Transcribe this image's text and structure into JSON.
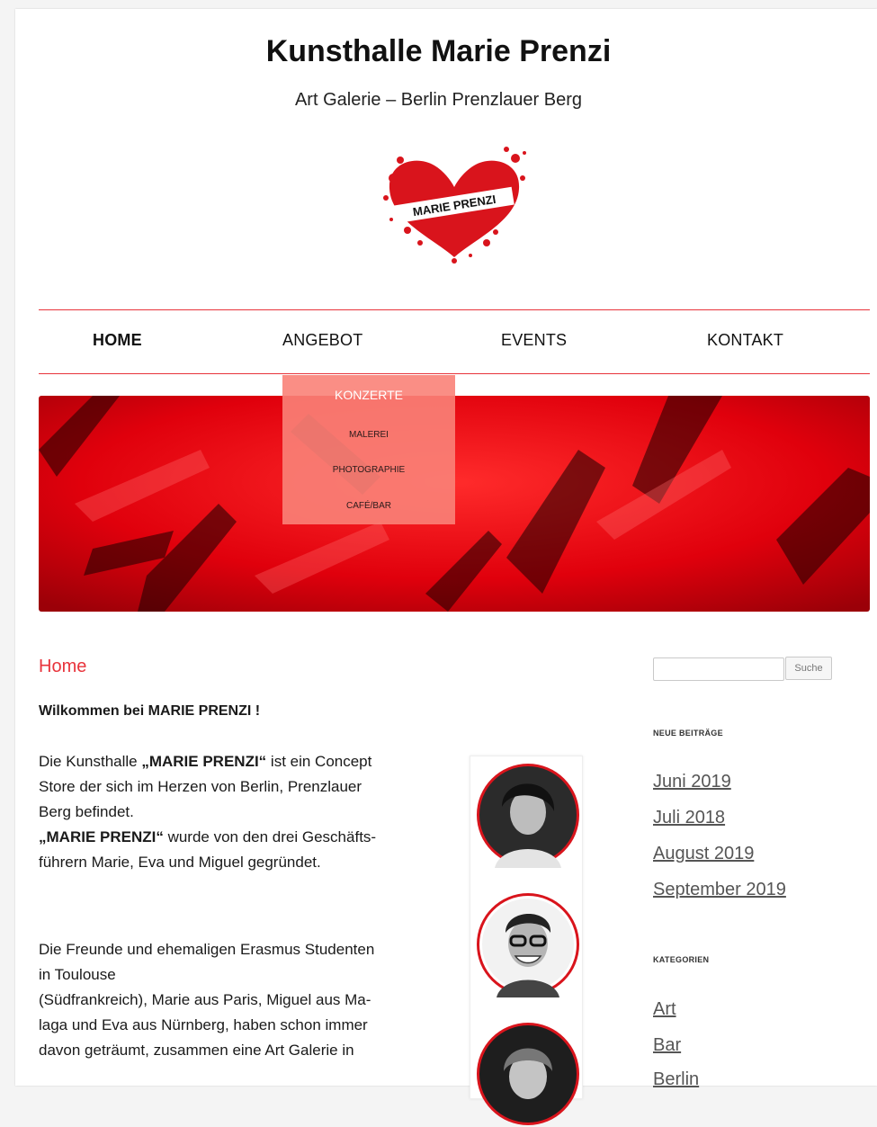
{
  "site": {
    "title": "Kunsthalle Marie Prenzi",
    "subtitle": "Art Galerie – Berlin Prenzlauer Berg",
    "logo_text": "MARIE PRENZI"
  },
  "nav": {
    "items": [
      {
        "label": "HOME",
        "active": true
      },
      {
        "label": "ANGEBOT",
        "active": false
      },
      {
        "label": "EVENTS",
        "active": false
      },
      {
        "label": "KONTAKT",
        "active": false
      }
    ],
    "dropdown": [
      "KONZERTE",
      "MALEREI",
      "PHOTOGRAPHIE",
      "CAFÉ/BAR"
    ]
  },
  "content": {
    "heading": "Home",
    "welcome": "Wilkommen bei MARIE PRENZI !",
    "p1": {
      "l1a": "Die Kunsthalle ",
      "l1b": "„MARIE PRENZI“",
      "l1c": " ist ein Concept",
      "l2": "Store der sich im Herzen von Berlin, Prenzlauer",
      "l3": "Berg befindet.",
      "l4a": "„MARIE PRENZI“",
      "l4b": " wurde von den drei Geschäfts-",
      "l5": "führern Marie, Eva und Miguel gegründet."
    },
    "p2": {
      "l1": "Die Freunde und ehemaligen Erasmus Studenten",
      "l2": "in Toulouse",
      "l3": "(Südfrankreich), Marie aus Paris, Miguel aus Ma-",
      "l4": "laga und Eva aus Nürnberg, haben schon immer",
      "l5": "davon geträumt, zusammen eine Art Galerie in"
    }
  },
  "sidebar": {
    "search_button": "Suche",
    "recent_title": "NEUE BEITRÄGE",
    "recent": [
      "Juni 2019",
      "Juli 2018",
      "August 2019",
      "September 2019"
    ],
    "categories_title": "KATEGORIEN",
    "categories": [
      "Art",
      "Bar",
      "Berlin"
    ]
  },
  "colors": {
    "accent": "#e8333b",
    "banner": "#d40010"
  }
}
